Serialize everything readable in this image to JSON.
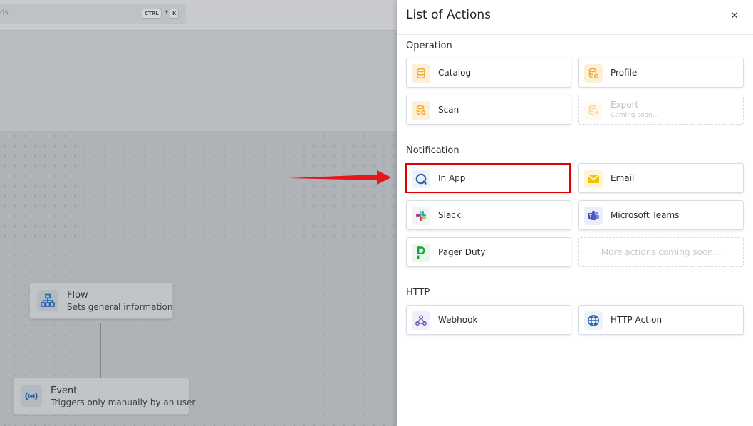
{
  "background": {
    "search": {
      "text": "ds",
      "shortcut_key1": "CTRL",
      "shortcut_plus": "+",
      "shortcut_key2": "K"
    },
    "nodes": [
      {
        "title": "Flow",
        "subtitle": "Sets general information",
        "icon": "flow-hierarchy-icon"
      },
      {
        "title": "Event",
        "subtitle": "Triggers only manually by an user",
        "icon": "broadcast-icon"
      }
    ]
  },
  "drawer": {
    "title": "List of Actions",
    "close_label": "×",
    "sections": {
      "operation": {
        "title": "Operation",
        "items": [
          {
            "label": "Catalog",
            "icon": "database-icon"
          },
          {
            "label": "Profile",
            "icon": "profile-database-icon"
          },
          {
            "label": "Scan",
            "icon": "scan-database-icon"
          },
          {
            "label": "Export",
            "sub": "Coming soon...",
            "icon": "export-icon",
            "disabled": true
          }
        ]
      },
      "notification": {
        "title": "Notification",
        "items": [
          {
            "label": "In App",
            "icon": "in-app-icon",
            "highlighted": true
          },
          {
            "label": "Email",
            "icon": "email-icon"
          },
          {
            "label": "Slack",
            "icon": "slack-icon"
          },
          {
            "label": "Microsoft Teams",
            "icon": "teams-icon"
          },
          {
            "label": "Pager Duty",
            "icon": "pagerduty-icon"
          },
          {
            "label": "More actions coming soon...",
            "disabled": true
          }
        ]
      },
      "http": {
        "title": "HTTP",
        "items": [
          {
            "label": "Webhook",
            "icon": "webhook-icon"
          },
          {
            "label": "HTTP Action",
            "icon": "globe-icon"
          }
        ]
      }
    }
  },
  "colors": {
    "highlight": "#e00000",
    "operation_accent": "#f5a623",
    "notification_brand": "#1f5ea8",
    "drawer_bg": "#ffffff"
  }
}
